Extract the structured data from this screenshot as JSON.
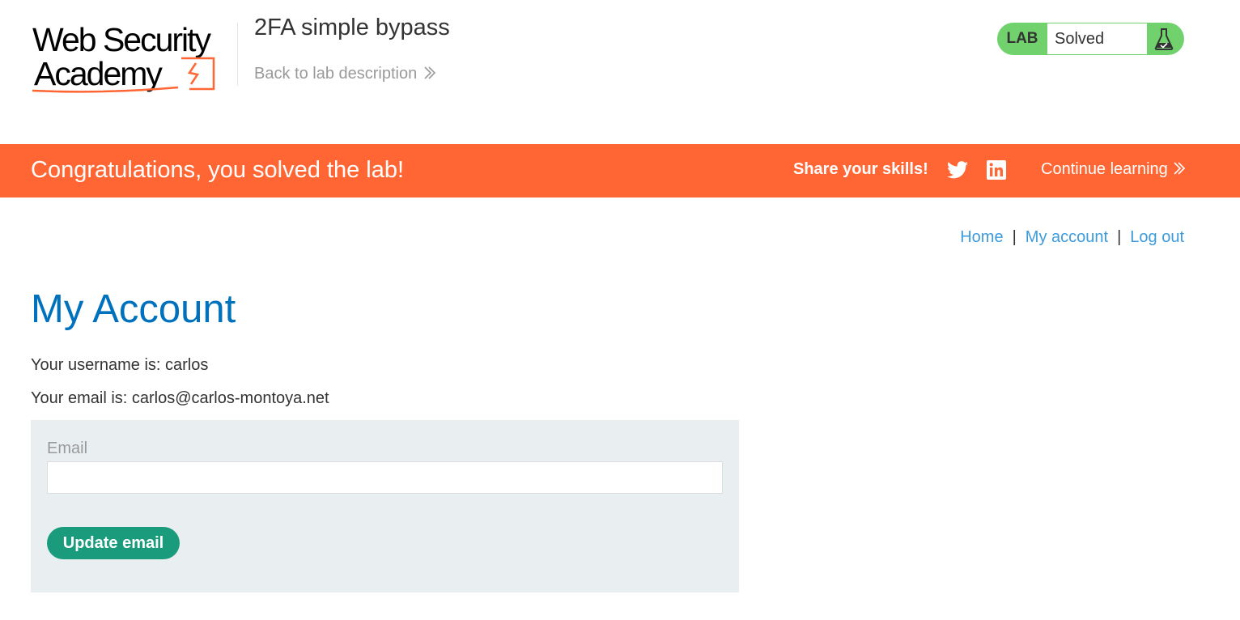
{
  "header": {
    "logo_text": "Web Security Academy",
    "lab_title": "2FA simple bypass",
    "back_link": "Back to lab description",
    "lab_status": {
      "tag": "LAB",
      "state": "Solved",
      "icon": "flask-icon"
    }
  },
  "banner": {
    "message": "Congratulations, you solved the lab!",
    "share_label": "Share your skills!",
    "twitter_icon": "twitter-icon",
    "linkedin_icon": "linkedin-icon",
    "continue_label": "Continue learning",
    "color": "#ff6633"
  },
  "nav": {
    "items": [
      "Home",
      "My account",
      "Log out"
    ],
    "separator": "|"
  },
  "main": {
    "title": "My Account",
    "username_line": "Your username is: carlos",
    "email_line": "Your email is: carlos@carlos-montoya.net",
    "form": {
      "email_label": "Email",
      "email_value": "",
      "submit_label": "Update email"
    }
  },
  "colors": {
    "accent_blue": "#0071bc",
    "link_blue": "#3d9bdc",
    "solved_green": "#70d16d",
    "button_green": "#1a9c7c",
    "panel_bg": "#e9eff1"
  }
}
